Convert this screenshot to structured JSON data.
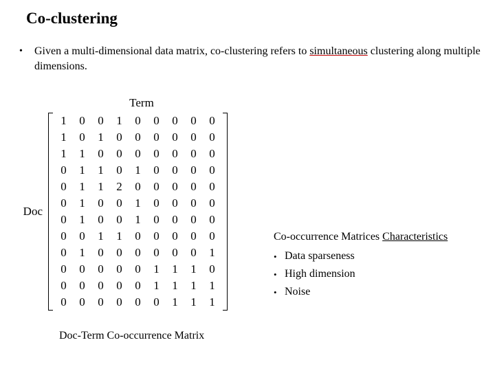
{
  "title": "Co-clustering",
  "body": {
    "prefix": "Given a multi-dimensional data matrix, co-clustering refers to ",
    "underlined": "simultaneous",
    "suffix": " clustering along multiple dimensions."
  },
  "labels": {
    "term": "Term",
    "doc": "Doc",
    "caption": "Doc-Term Co-occurrence Matrix"
  },
  "characteristics": {
    "heading_part1": "Co-occurrence Matrices ",
    "heading_part2": "Characteristics",
    "items": [
      "Data sparseness",
      "High dimension",
      "Noise"
    ]
  },
  "chart_data": {
    "type": "table",
    "title": "Doc-Term Co-occurrence Matrix",
    "row_label": "Doc",
    "col_label": "Term",
    "rows": 12,
    "cols": 9,
    "values": [
      [
        1,
        0,
        0,
        1,
        0,
        0,
        0,
        0,
        0
      ],
      [
        1,
        0,
        1,
        0,
        0,
        0,
        0,
        0,
        0
      ],
      [
        1,
        1,
        0,
        0,
        0,
        0,
        0,
        0,
        0
      ],
      [
        0,
        1,
        1,
        0,
        1,
        0,
        0,
        0,
        0
      ],
      [
        0,
        1,
        1,
        2,
        0,
        0,
        0,
        0,
        0
      ],
      [
        0,
        1,
        0,
        0,
        1,
        0,
        0,
        0,
        0
      ],
      [
        0,
        1,
        0,
        0,
        1,
        0,
        0,
        0,
        0
      ],
      [
        0,
        0,
        1,
        1,
        0,
        0,
        0,
        0,
        0
      ],
      [
        0,
        1,
        0,
        0,
        0,
        0,
        0,
        0,
        1
      ],
      [
        0,
        0,
        0,
        0,
        0,
        1,
        1,
        1,
        0
      ],
      [
        0,
        0,
        0,
        0,
        0,
        1,
        1,
        1,
        1
      ],
      [
        0,
        0,
        0,
        0,
        0,
        0,
        1,
        1,
        1
      ]
    ]
  }
}
